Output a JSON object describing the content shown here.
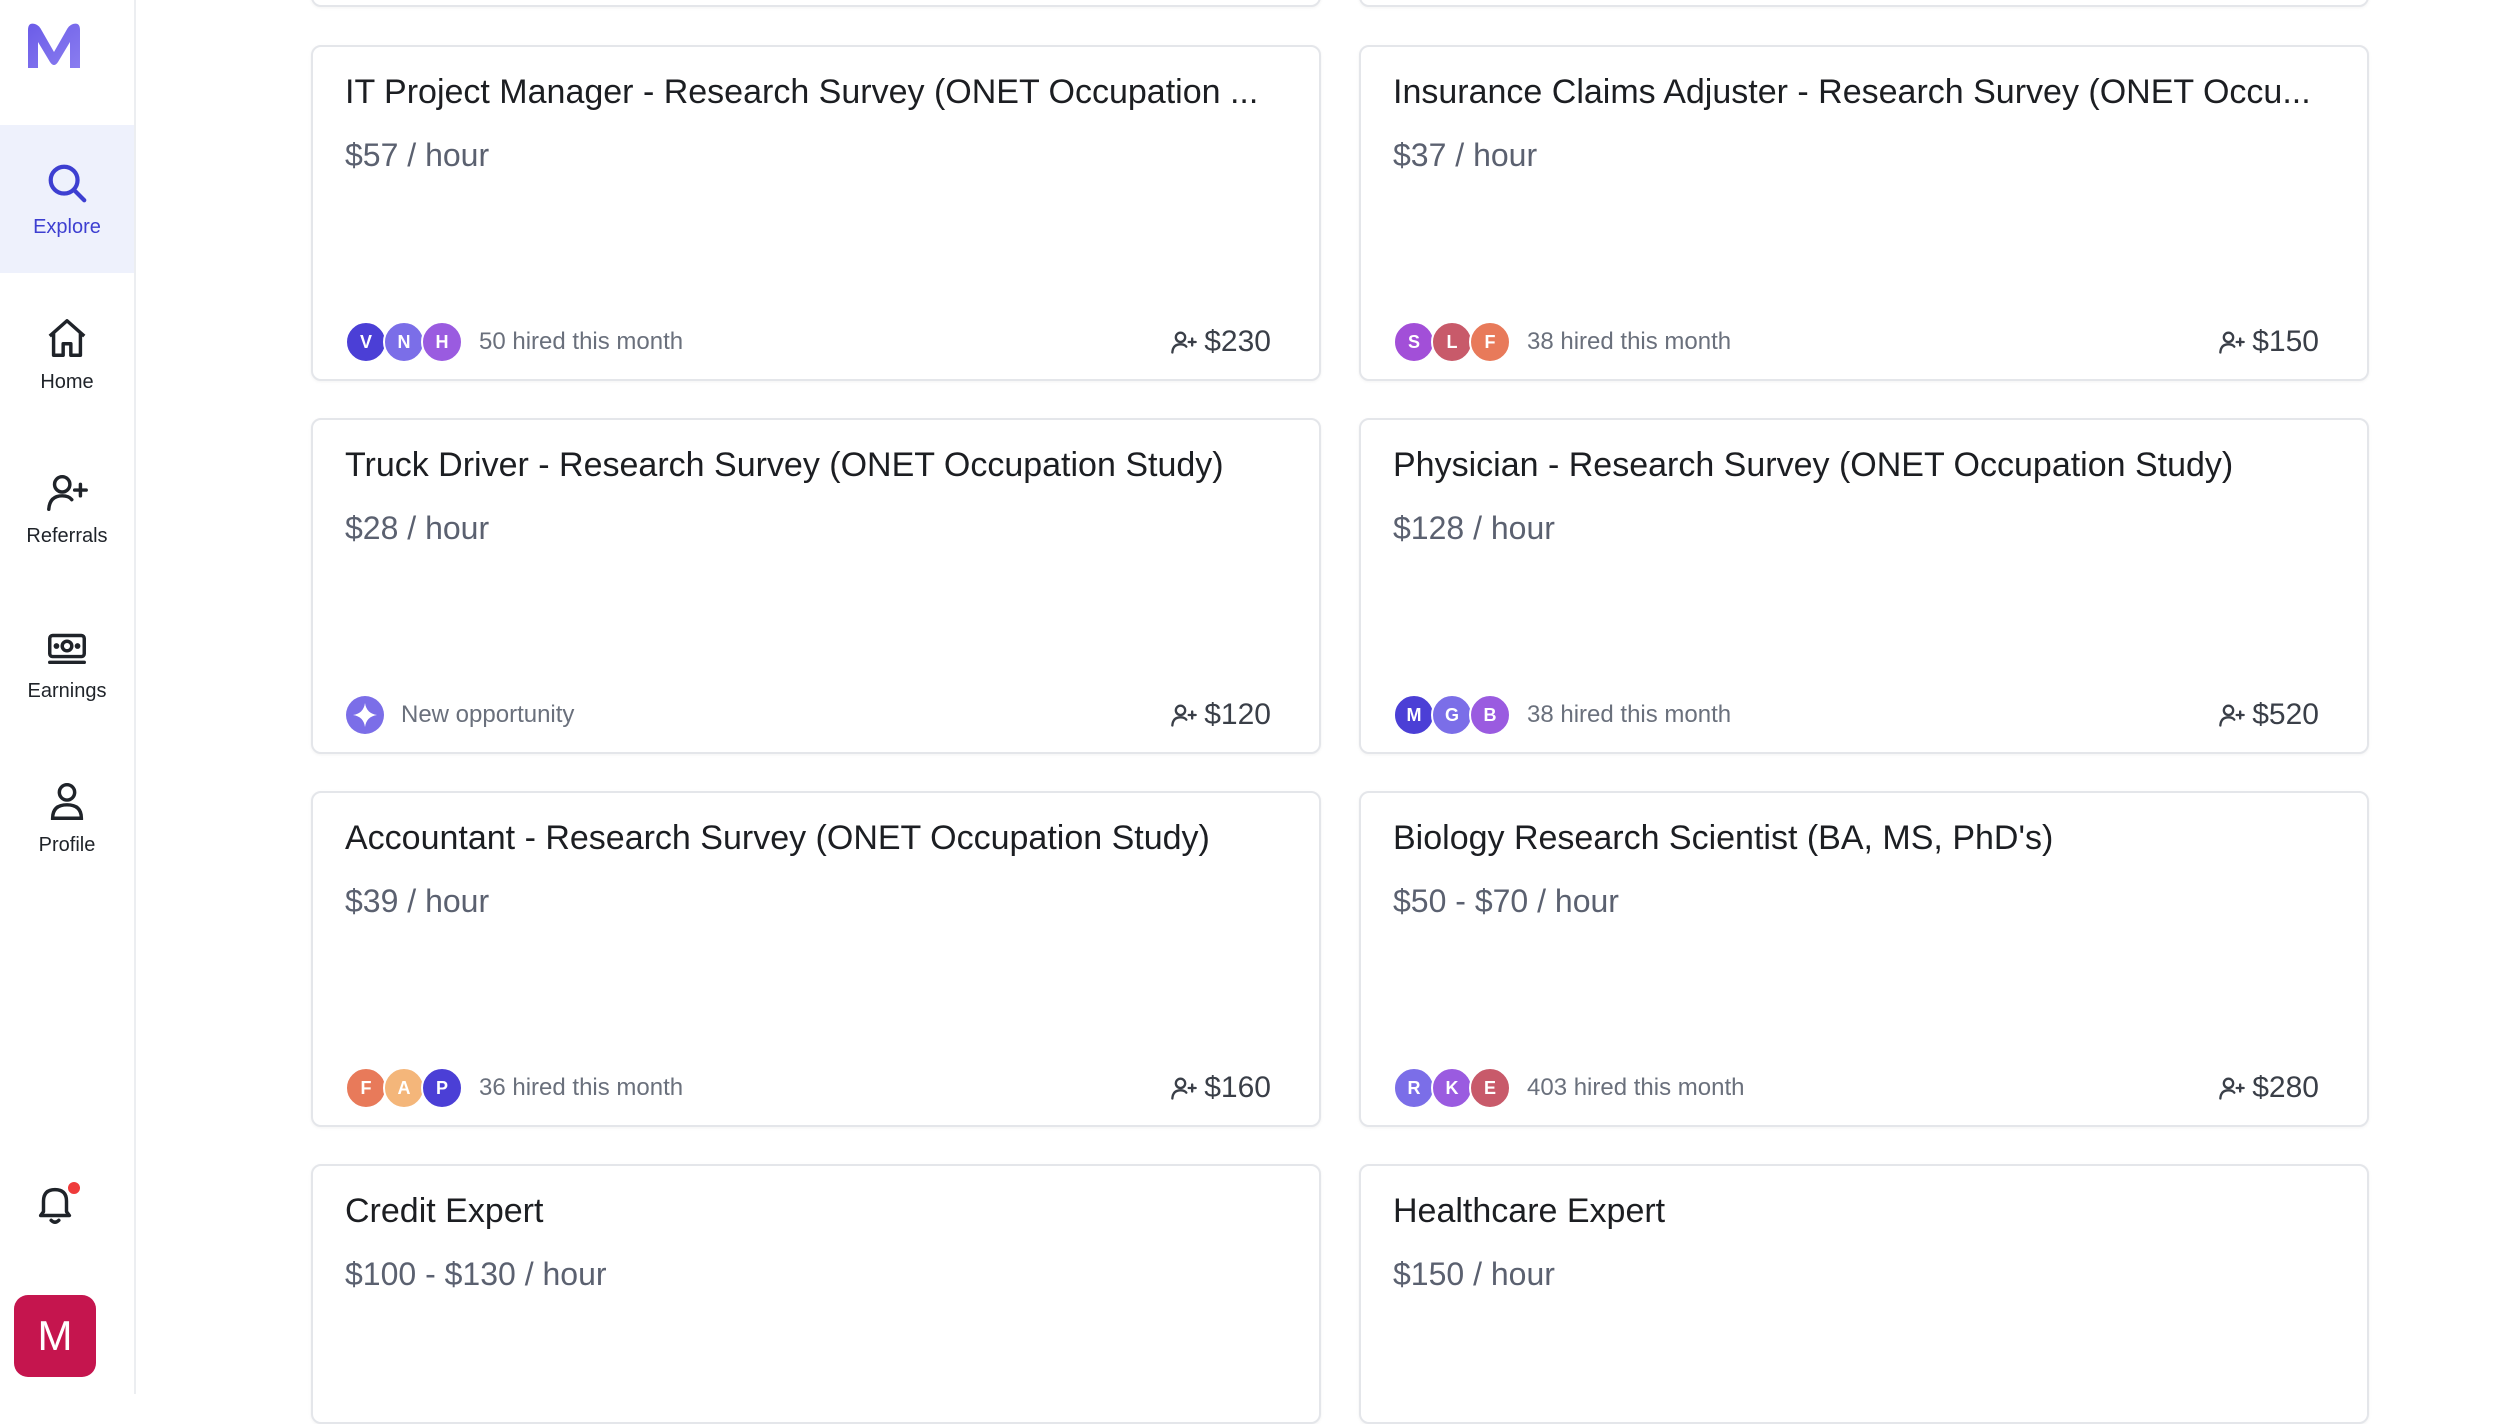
{
  "sidebar": {
    "logo_letter": "M",
    "items": [
      {
        "label": "Explore",
        "icon": "search-icon",
        "active": true
      },
      {
        "label": "Home",
        "icon": "home-icon",
        "active": false
      },
      {
        "label": "Referrals",
        "icon": "user-plus-icon",
        "active": false
      },
      {
        "label": "Earnings",
        "icon": "cash-icon",
        "active": false
      },
      {
        "label": "Profile",
        "icon": "user-icon",
        "active": false
      }
    ],
    "notifications_icon": "bell-icon",
    "has_unread": true,
    "user_initial": "M"
  },
  "colors": {
    "accent": "#3d3fd1",
    "active_bg": "#eef1fc",
    "user_avatar": "#c5154e",
    "notification_dot": "#ef3b3b"
  },
  "cards": [
    {
      "title": "IT Project Manager - Research Survey (ONET Occupation ...",
      "rate": "$57 / hour",
      "avatars": [
        {
          "letter": "V",
          "color": "#4b3fd6"
        },
        {
          "letter": "N",
          "color": "#7b6ee8"
        },
        {
          "letter": "H",
          "color": "#9a5be0"
        }
      ],
      "hired": "50 hired this month",
      "bonus": "$230"
    },
    {
      "title": "Insurance Claims Adjuster - Research Survey (ONET Occu...",
      "rate": "$37 / hour",
      "avatars": [
        {
          "letter": "S",
          "color": "#a24fd8"
        },
        {
          "letter": "L",
          "color": "#c85a6a"
        },
        {
          "letter": "F",
          "color": "#e87a5a"
        }
      ],
      "hired": "38 hired this month",
      "bonus": "$150"
    },
    {
      "title": "Truck Driver - Research Survey (ONET Occupation Study)",
      "rate": "$28 / hour",
      "new": true,
      "new_label": "New opportunity",
      "bonus": "$120"
    },
    {
      "title": "Physician - Research Survey (ONET Occupation Study)",
      "rate": "$128 / hour",
      "avatars": [
        {
          "letter": "M",
          "color": "#4b3fd6"
        },
        {
          "letter": "G",
          "color": "#7b6ee8"
        },
        {
          "letter": "B",
          "color": "#9a5be0"
        }
      ],
      "hired": "38 hired this month",
      "bonus": "$520"
    },
    {
      "title": "Accountant - Research Survey (ONET Occupation Study)",
      "rate": "$39 / hour",
      "avatars": [
        {
          "letter": "F",
          "color": "#e87a5a"
        },
        {
          "letter": "A",
          "color": "#f4b67a"
        },
        {
          "letter": "P",
          "color": "#4b3fd6"
        }
      ],
      "hired": "36 hired this month",
      "bonus": "$160"
    },
    {
      "title": "Biology Research Scientist (BA, MS, PhD's)",
      "rate": "$50 - $70 / hour",
      "avatars": [
        {
          "letter": "R",
          "color": "#7b6ee8"
        },
        {
          "letter": "K",
          "color": "#9a5be0"
        },
        {
          "letter": "E",
          "color": "#c85a6a"
        }
      ],
      "hired": "403 hired this month",
      "bonus": "$280"
    },
    {
      "title": "Credit Expert",
      "rate": "$100 - $130 / hour"
    },
    {
      "title": "Healthcare Expert",
      "rate": "$150 / hour"
    }
  ]
}
